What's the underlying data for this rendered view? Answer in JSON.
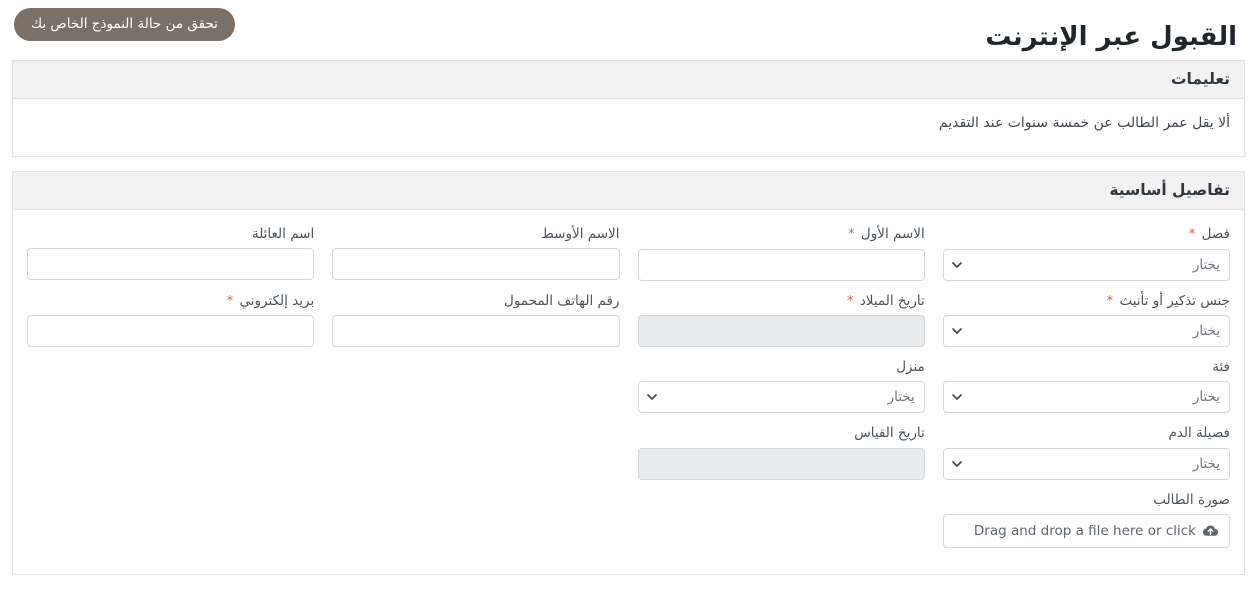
{
  "header": {
    "title": "القبول عبر الإنترنت",
    "status_button": "تحقق من حالة النموذج الخاص بك"
  },
  "instructions": {
    "heading": "تعليمات",
    "text": "ألا يقل عمر الطالب عن خمسة سنوات عند التقديم"
  },
  "basic_details": {
    "heading": "تفاصيل أساسية",
    "select_placeholder": "يختار",
    "fields": [
      {
        "label": "فصل",
        "required": true,
        "type": "select",
        "value": "يختار"
      },
      {
        "label": "الاسم الأول",
        "required": true,
        "type": "text",
        "value": ""
      },
      {
        "label": "الاسم الأوسط",
        "required": false,
        "type": "text",
        "value": ""
      },
      {
        "label": "اسم العائلة",
        "required": false,
        "type": "text",
        "value": ""
      },
      {
        "label": "جنس تذكير أو تأنيث",
        "required": true,
        "type": "select",
        "value": "يختار"
      },
      {
        "label": "تاريخ الميلاد",
        "required": true,
        "type": "date",
        "value": "",
        "disabled": true
      },
      {
        "label": "رقم الهاتف المحمول",
        "required": false,
        "type": "text",
        "value": ""
      },
      {
        "label": "بريد إلكتروني",
        "required": true,
        "type": "text",
        "value": ""
      },
      {
        "label": "فئة",
        "required": false,
        "type": "select",
        "value": "يختار"
      },
      {
        "label": "منزل",
        "required": false,
        "type": "select",
        "value": "يختار"
      },
      {
        "label": "فصيلة الدم",
        "required": false,
        "type": "select",
        "value": "يختار"
      },
      {
        "label": "تاريخ القياس",
        "required": false,
        "type": "date",
        "value": "",
        "disabled": true
      },
      {
        "label": "صورة الطالب",
        "required": false,
        "type": "file",
        "value": "Drag and drop a file here or click"
      }
    ]
  },
  "colors": {
    "status_button_bg": "#7a7068",
    "required_asterisk": "#e05c4a",
    "panel_header_bg": "#f2f2f2",
    "panel_border": "#e2e2e2",
    "input_border": "#d6d9dc",
    "disabled_bg": "#e9eaeb"
  }
}
